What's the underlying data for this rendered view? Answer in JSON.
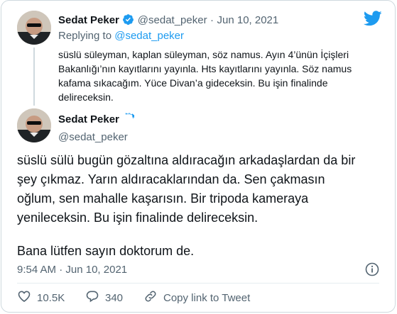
{
  "quoted": {
    "name": "Sedat Peker",
    "handle": "@sedat_peker",
    "separator": "·",
    "date": "Jun 10, 2021",
    "replying_label": "Replying to",
    "replying_handle": "@sedat_peker",
    "text_lines": [
      "süslü süleyman, kaplan süleyman, söz namus. Ayın 4’ünün İçişleri",
      "Bakanlığı’nın kayıtlarını yayınla. Hts kayıtlarını yayınla. Söz namus",
      "kafama sıkacağım. Yüce Divan’a gideceksin. Bu işin finalinde",
      "delireceksin."
    ]
  },
  "main": {
    "name": "Sedat Peker",
    "handle": "@sedat_peker",
    "text_lines": [
      "süslü sülü bugün gözaltına aldıracağın arkadaşlardan da bir",
      "şey çıkmaz. Yarın aldıracaklarından da. Sen çakmasın",
      "oğlum, sen mahalle kaşarısın. Bir tripoda kameraya",
      "yenileceksin. Bu işin finalinde delireceksin."
    ],
    "text_line_last": "Bana lütfen sayın doktorum de.",
    "time": "9:54 AM",
    "separator": "·",
    "date": "Jun 10, 2021"
  },
  "actions": {
    "likes": "10.5K",
    "replies": "340",
    "copy_link": "Copy link to Tweet"
  },
  "colors": {
    "brand": "#1d9bf0",
    "text": "#0f1419",
    "muted": "#536471",
    "like": "#f91880",
    "border": "#cfd9de"
  },
  "icons": {
    "brand": "twitter-bird-icon",
    "verified": "verified-badge-icon",
    "info": "info-icon",
    "like": "heart-icon",
    "reply": "reply-bubble-icon",
    "copy": "link-icon"
  }
}
